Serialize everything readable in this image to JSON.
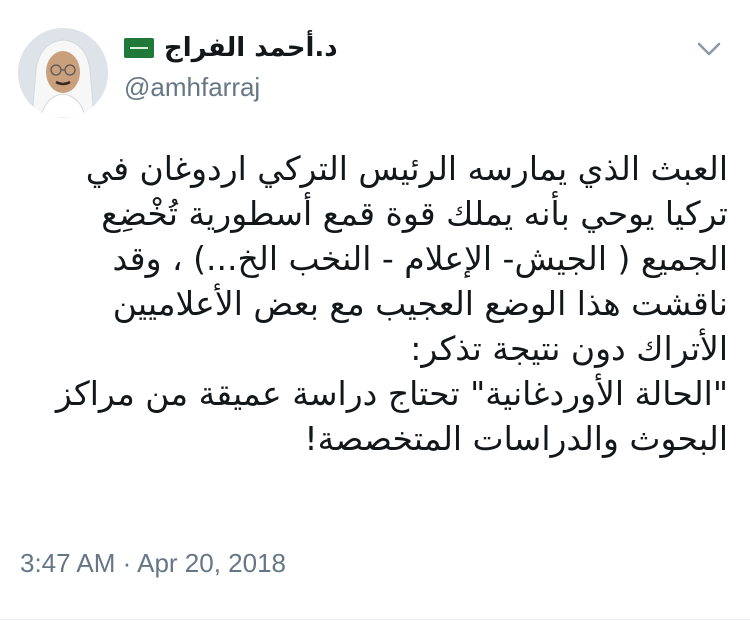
{
  "author": {
    "display_name": "د.أحمد الفراج",
    "handle": "@amhfarraj",
    "badge_icon": "saudi-flag-icon",
    "avatar_icon": "profile-photo"
  },
  "tweet": {
    "text": "العبث الذي يمارسه الرئيس التركي اردوغان في\nتركيا يوحي بأنه يملك قوة قمع أسطورية تُخْضِع\nالجميع ( الجيش- الإعلام - النخب الخ...) ، وقد\nناقشت هذا الوضع العجيب مع بعض الأعلاميين\nالأتراك دون نتيجة تذكر:\n\"الحالة الأوردغانية\" تحتاج دراسة عميقة من مراكز\nالبحوث والدراسات المتخصصة!",
    "time": "3:47 AM",
    "separator": "·",
    "date": "Apr 20, 2018"
  },
  "menu": {
    "icon": "chevron-down-icon"
  },
  "colors": {
    "text": "#14171a",
    "secondary": "#657786",
    "flag_green": "#1f7a3a"
  }
}
